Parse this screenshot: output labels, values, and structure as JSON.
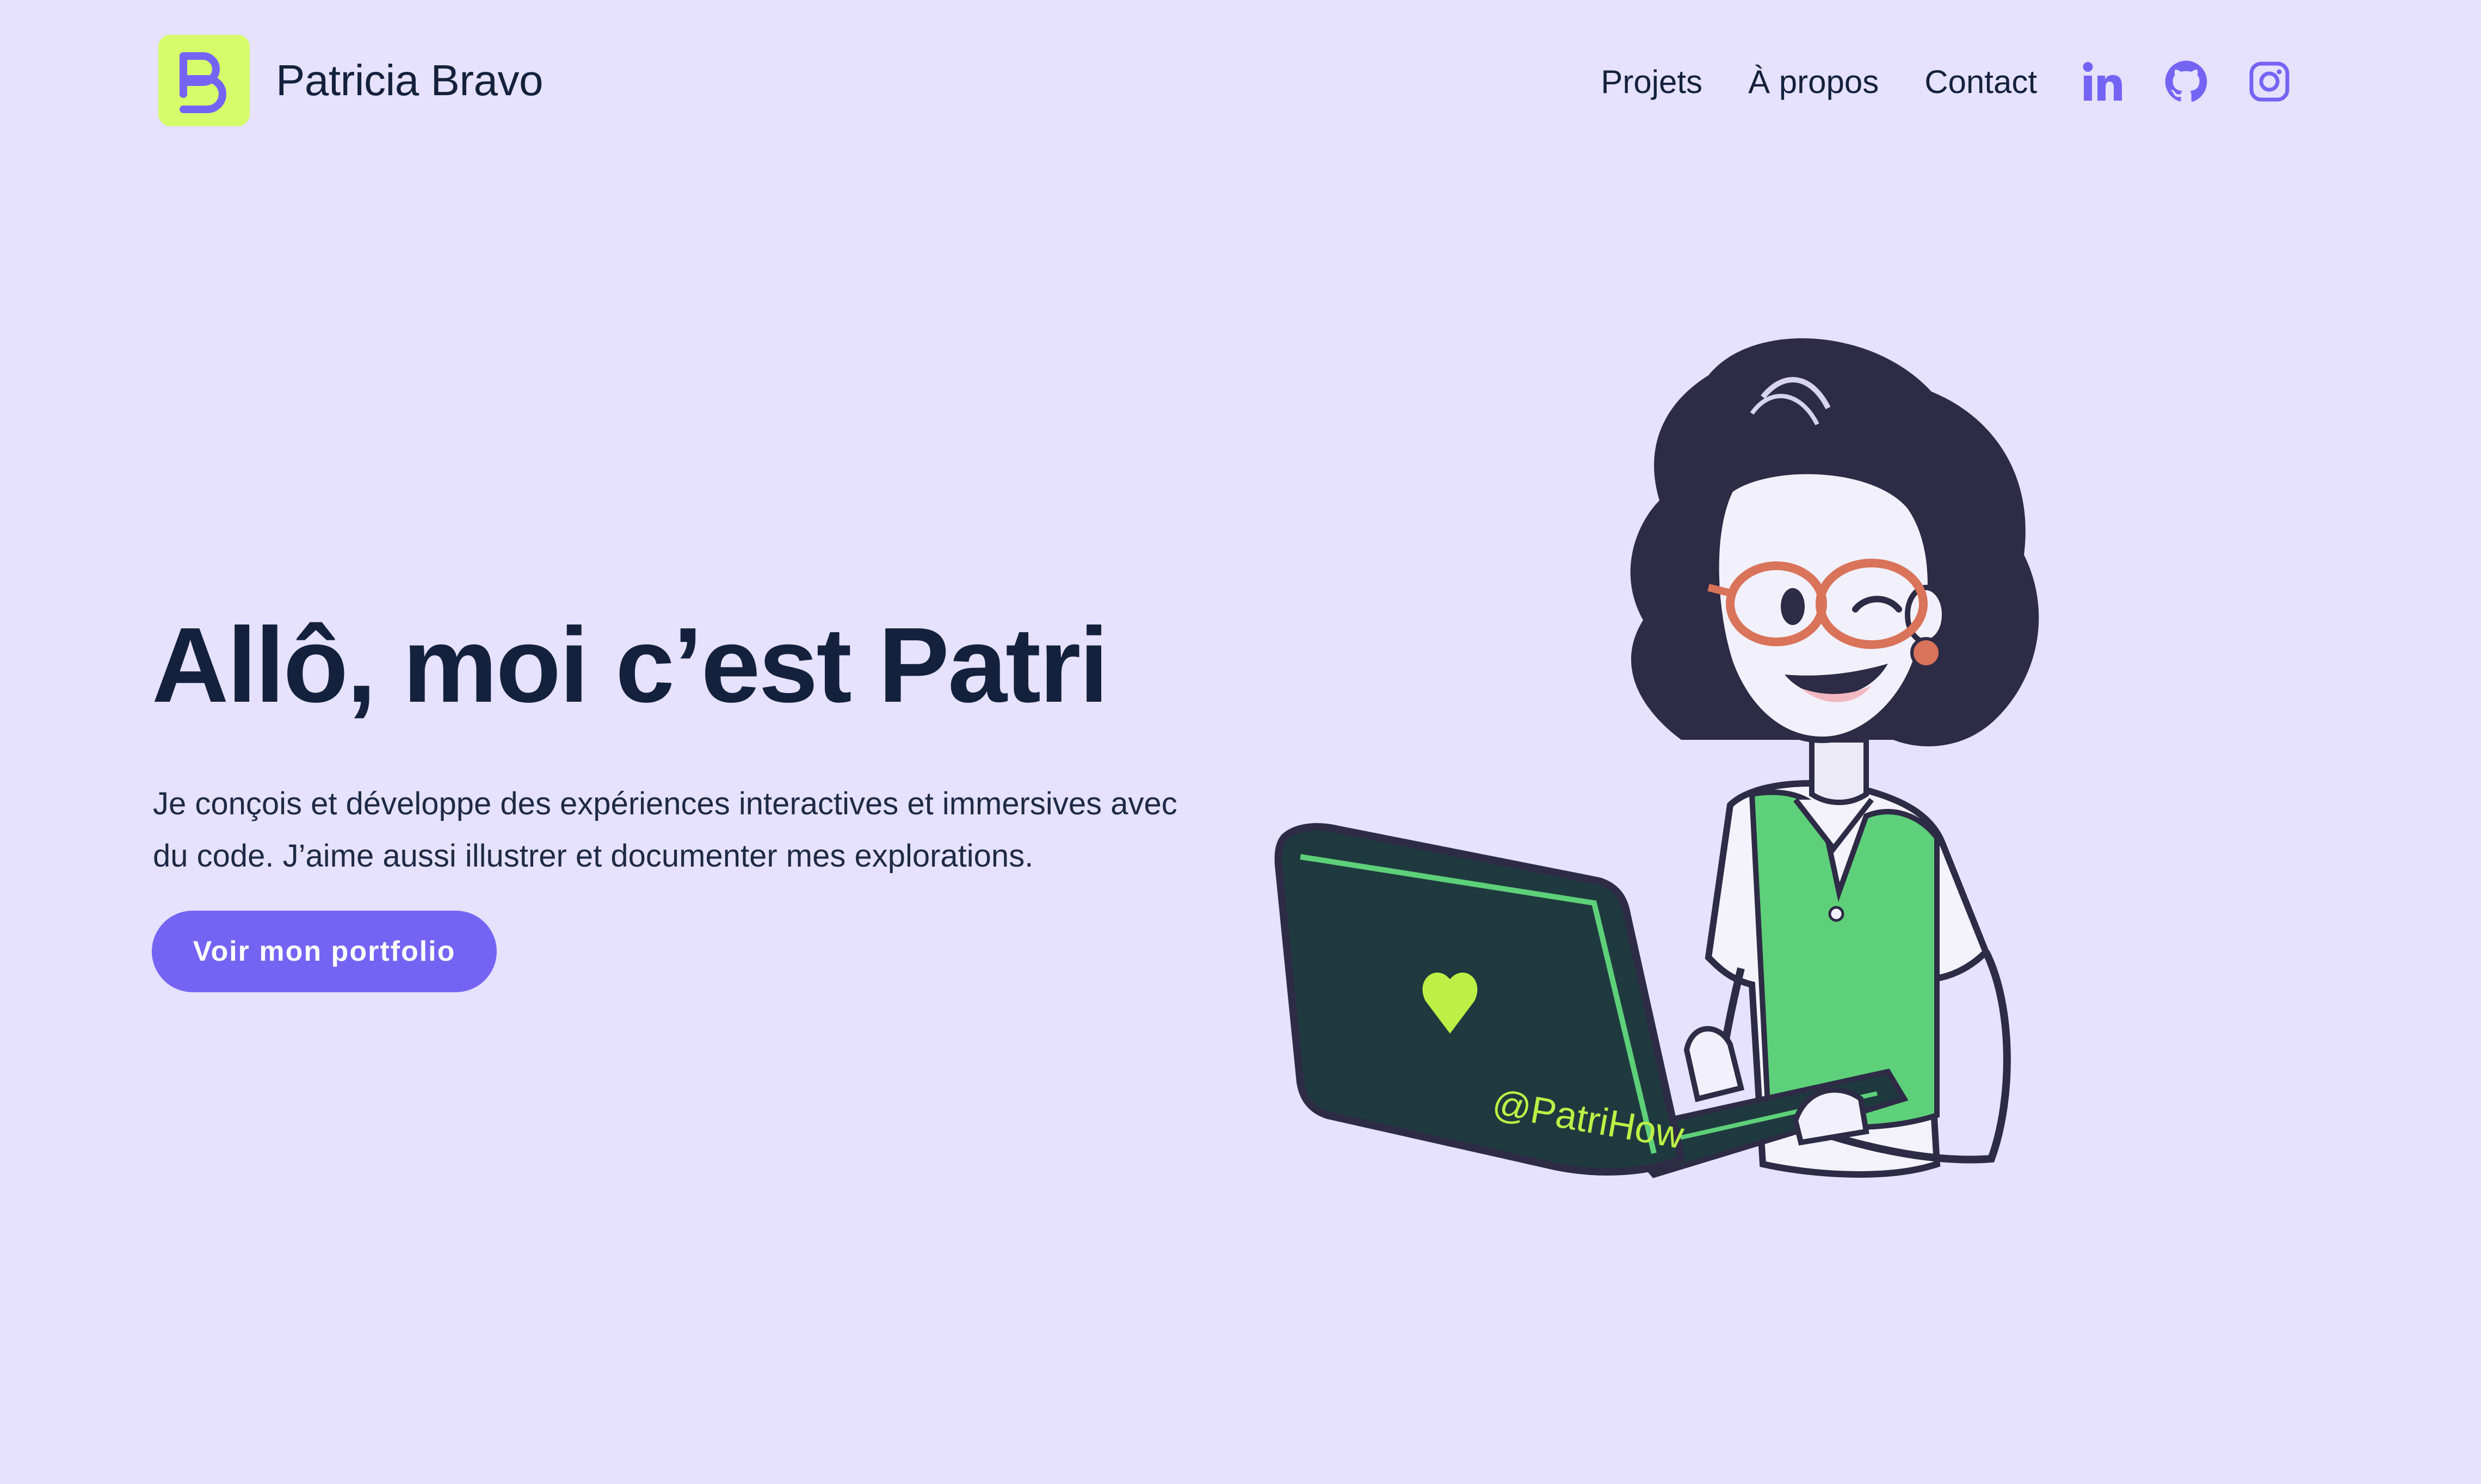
{
  "header": {
    "brand_name": "Patricia Bravo",
    "logo_icon": "pb-monogram-icon",
    "nav": [
      {
        "label": "Projets"
      },
      {
        "label": "À propos"
      },
      {
        "label": "Contact"
      }
    ],
    "social": [
      "linkedin-icon",
      "github-icon",
      "instagram-icon"
    ]
  },
  "hero": {
    "title": "Allô, moi c’est Patri",
    "description": "Je conçois et développe des expériences interactives et immersives avec du code. J’aime aussi illustrer et documenter mes explorations.",
    "cta_label": "Voir mon portfolio",
    "laptop_handle": "@PatriHow"
  },
  "colors": {
    "background": "#E6E1FC",
    "accent": "#7564F4",
    "logo_bg": "#D6FB6B",
    "text": "#14213D"
  }
}
